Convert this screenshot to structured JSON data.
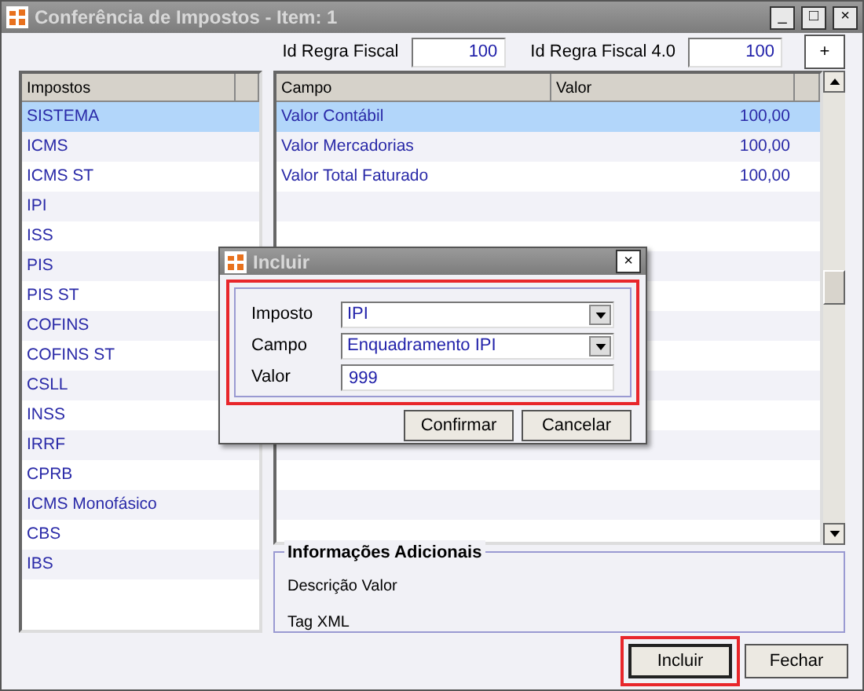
{
  "window": {
    "title": "Conferência de Impostos - Item: 1",
    "buttons": [
      "_",
      "□",
      "×"
    ]
  },
  "toolbar": {
    "fields": [
      {
        "label": "Id Regra Fiscal",
        "value": "100"
      },
      {
        "label": "Id Regra Fiscal 4.0",
        "value": "100"
      }
    ],
    "add_button": "+"
  },
  "taxes": {
    "column": "Impostos",
    "items": [
      {
        "label": "SISTEMA",
        "selected": true
      },
      {
        "label": "ICMS",
        "selected": false
      },
      {
        "label": "ICMS ST",
        "selected": false
      },
      {
        "label": "IPI",
        "selected": false
      },
      {
        "label": "ISS",
        "selected": false
      },
      {
        "label": "PIS",
        "selected": false
      },
      {
        "label": "PIS ST",
        "selected": false
      },
      {
        "label": "COFINS",
        "selected": false
      },
      {
        "label": "COFINS ST",
        "selected": false
      },
      {
        "label": "CSLL",
        "selected": false
      },
      {
        "label": "INSS",
        "selected": false
      },
      {
        "label": "IRRF",
        "selected": false
      },
      {
        "label": "CPRB",
        "selected": false
      },
      {
        "label": "ICMS Monofásico",
        "selected": false
      },
      {
        "label": "CBS",
        "selected": false
      },
      {
        "label": "IBS",
        "selected": false
      }
    ]
  },
  "fields_table": {
    "columns": [
      "Campo",
      "Valor"
    ],
    "rows": [
      {
        "campo": "Valor Contábil",
        "valor": "100,00",
        "selected": true
      },
      {
        "campo": "Valor Mercadorias",
        "valor": "100,00",
        "selected": false
      },
      {
        "campo": "Valor Total Faturado",
        "valor": "100,00",
        "selected": false
      }
    ]
  },
  "info": {
    "title": "Informações Adicionais",
    "lines": [
      "Descrição Valor",
      "Tag XML"
    ]
  },
  "dialog": {
    "title": "Incluir",
    "close": "×",
    "highlighted": true,
    "fields": [
      {
        "kind": "select",
        "label": "Imposto",
        "value": "IPI"
      },
      {
        "kind": "select",
        "label": "Campo",
        "value": "Enquadramento IPI"
      },
      {
        "kind": "text",
        "label": "Valor",
        "value": "999"
      }
    ],
    "buttons": [
      "Confirmar",
      "Cancelar"
    ]
  },
  "footer_buttons": [
    {
      "label": "Incluir",
      "highlighted": true
    },
    {
      "label": "Fechar",
      "highlighted": false
    }
  ]
}
